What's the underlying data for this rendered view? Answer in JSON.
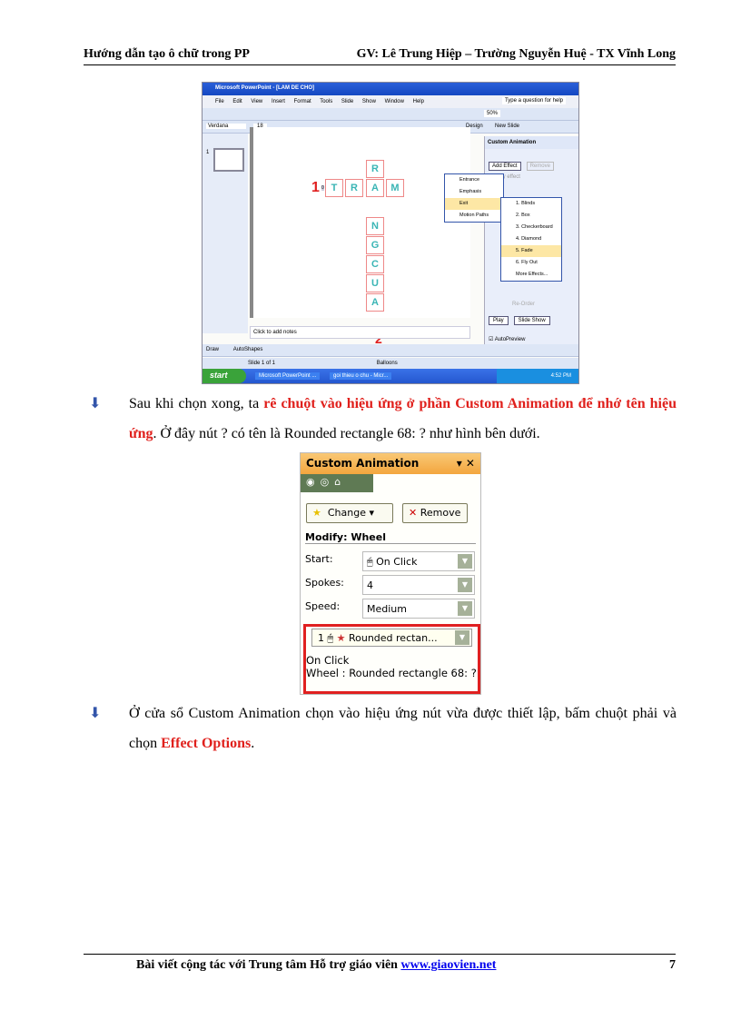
{
  "header": {
    "left": "Hướng dẫn tạo ô chữ trong PP",
    "right": "GV: Lê Trung Hiệp – Trường Nguyễn Huệ - TX Vĩnh Long"
  },
  "screenshot1": {
    "title": "Microsoft PowerPoint - [LAM DE CHO]",
    "menu": [
      "File",
      "Edit",
      "View",
      "Insert",
      "Format",
      "Tools",
      "Slide Show",
      "Window",
      "Help"
    ],
    "help_placeholder": "Type a question for help",
    "font": "Verdana",
    "font_size": "18",
    "zoom": "50%",
    "design": "Design",
    "new_slide": "New Slide",
    "slide_number": "1",
    "clue_left": "1",
    "clue_bottom": "2",
    "small_label": "0",
    "horizontal": [
      "T",
      "R",
      "A",
      "M"
    ],
    "vertical": [
      "R",
      "A",
      "N",
      "G",
      "C",
      "U",
      "A"
    ],
    "pane_title": "Custom Animation",
    "add_effect": "Add Effect",
    "remove": "Remove",
    "modify_hint": "fy effect",
    "menu1": [
      "Entrance",
      "Emphasis",
      "Exit",
      "Motion Paths"
    ],
    "menu2": [
      "1. Blinds",
      "2. Box",
      "3. Checkerboard",
      "4. Diamond",
      "5. Fade",
      "6. Fly Out",
      "More Effects..."
    ],
    "reorder": "Re-Order",
    "play": "Play",
    "slide_show": "Slide Show",
    "autopreview": "AutoPreview",
    "notes": "Click to add notes",
    "draw": "Draw",
    "autoshapes": "AutoShapes",
    "status_slide": "Slide 1 of 1",
    "status_design": "Balloons",
    "start": "start",
    "task1": "Microsoft PowerPoint ...",
    "task2": "goi thieu o chu - Micr...",
    "clock": "4:52 PM"
  },
  "para1": {
    "t1": "Sau khi chọn xong, ta ",
    "r1": "rê chuột vào hiệu ứng ở phần Custom Animation để nhớ tên hiệu ứng",
    "t2": ". Ở đây nút ? có tên là Rounded rectangle 68: ? như hình bên dưới."
  },
  "screenshot2": {
    "title": "Custom Animation",
    "change": "Change",
    "remove": "Remove",
    "modify": "Modify: Wheel",
    "start_label": "Start:",
    "start_value": "On Click",
    "spokes_label": "Spokes:",
    "spokes_value": "4",
    "speed_label": "Speed:",
    "speed_value": "Medium",
    "item_num": "1",
    "item_name": "Rounded rectan...",
    "tip1": "On Click",
    "tip2": "Wheel : Rounded rectangle 68: ?",
    "highlight_color": "#e02020"
  },
  "para2": {
    "t1": "Ở cửa sổ Custom Animation chọn vào hiệu ứng nút vừa được thiết lập, bấm chuột phải và chọn ",
    "r1": "Effect Options",
    "t2": "."
  },
  "footer": {
    "text": "Bài viết cộng tác với Trung tâm Hỗ trợ giáo viên ",
    "link": "www.giaovien.net",
    "page": "7"
  }
}
